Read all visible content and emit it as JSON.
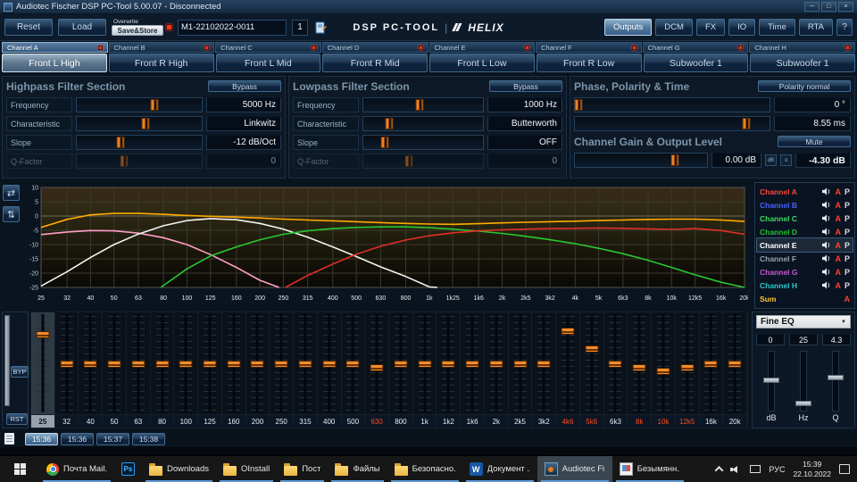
{
  "titlebar": {
    "title": "Audiotec Fischer DSP PC-Tool 5.00.07 - Disconnected"
  },
  "toolbar": {
    "reset": "Reset",
    "load": "Load",
    "overwrite_label": "Overwrite",
    "save_store": "Save&Store",
    "preset_name": "M1-22102022-0011",
    "preset_number": "1",
    "logo_left": "DSP PC-TOOL",
    "logo_sep": "|",
    "logo_brand": "HELIX",
    "right_buttons": [
      "Outputs",
      "DCM",
      "FX",
      "IO",
      "Time",
      "RTA"
    ],
    "help": "?"
  },
  "channel_tabs": [
    {
      "label": "Channel A",
      "active": true
    },
    {
      "label": "Channel B"
    },
    {
      "label": "Channel C"
    },
    {
      "label": "Channel D"
    },
    {
      "label": "Channel E"
    },
    {
      "label": "Channel F"
    },
    {
      "label": "Channel G"
    },
    {
      "label": "Channel H"
    }
  ],
  "channel_buttons": [
    {
      "label": "Front L High",
      "active": true
    },
    {
      "label": "Front R High"
    },
    {
      "label": "Front L Mid"
    },
    {
      "label": "Front R Mid"
    },
    {
      "label": "Front L Low"
    },
    {
      "label": "Front R Low"
    },
    {
      "label": "Subwoofer 1"
    },
    {
      "label": "Subwoofer 1"
    }
  ],
  "highpass": {
    "title": "Highpass Filter Section",
    "bypass": "Bypass",
    "rows": [
      {
        "label": "Frequency",
        "value": "5000 Hz",
        "pos": 62
      },
      {
        "label": "Characteristic",
        "value": "Linkwitz",
        "pos": 55
      },
      {
        "label": "Slope",
        "value": "-12 dB/Oct",
        "pos": 35
      },
      {
        "label": "Q-Factor",
        "value": "0",
        "pos": 38,
        "disabled": true
      }
    ]
  },
  "lowpass": {
    "title": "Lowpass Filter Section",
    "bypass": "Bypass",
    "rows": [
      {
        "label": "Frequency",
        "value": "1000 Hz",
        "pos": 47
      },
      {
        "label": "Characteristic",
        "value": "Butterworth",
        "pos": 22
      },
      {
        "label": "Slope",
        "value": "OFF",
        "pos": 18
      },
      {
        "label": "Q-Factor",
        "value": "0",
        "pos": 38,
        "disabled": true
      }
    ]
  },
  "phase": {
    "title": "Phase, Polarity & Time",
    "polarity_button": "Polarity normal",
    "deg_value": "0 °",
    "deg_pos": 2,
    "ms_value": "8.55 ms",
    "ms_pos": 88
  },
  "gain": {
    "title": "Channel Gain & Output Level",
    "mute_button": "Mute",
    "gain_value": "0.00 dB",
    "gain_pos": 76,
    "level_value": "-4.30 dB"
  },
  "chart_data": {
    "type": "line",
    "x_scale": "log",
    "xlim": [
      25,
      20000
    ],
    "ylim": [
      -25,
      10
    ],
    "ylabel": "dB",
    "xlabel": "Hz",
    "grid": true,
    "y_ticks": [
      10,
      5,
      0,
      -5,
      -10,
      -15,
      -20,
      -25
    ],
    "x_ticks": [
      25,
      32,
      40,
      50,
      63,
      80,
      100,
      125,
      160,
      200,
      250,
      315,
      400,
      500,
      630,
      800,
      1000,
      1250,
      1600,
      2000,
      2500,
      3150,
      4000,
      5000,
      6300,
      8000,
      10000,
      12500,
      16000,
      20000
    ],
    "x_tick_labels": [
      "25",
      "32",
      "40",
      "50",
      "63",
      "80",
      "100",
      "125",
      "160",
      "200",
      "250",
      "315",
      "400",
      "500",
      "630",
      "800",
      "1k",
      "1k25",
      "1k6",
      "2k",
      "2k5",
      "3k2",
      "4k",
      "5k",
      "6k3",
      "8k",
      "10k",
      "12k5",
      "16k",
      "20k"
    ],
    "series": [
      {
        "name": "orange",
        "color": "#ffaa00",
        "points": [
          [
            25,
            -4
          ],
          [
            32,
            -1.2
          ],
          [
            40,
            0.4
          ],
          [
            50,
            0.9
          ],
          [
            63,
            0.9
          ],
          [
            80,
            0.6
          ],
          [
            100,
            0.2
          ],
          [
            125,
            -0.1
          ],
          [
            160,
            -0.4
          ],
          [
            200,
            -0.7
          ],
          [
            250,
            -1.1
          ],
          [
            315,
            -1.4
          ],
          [
            400,
            -1.7
          ],
          [
            500,
            -2
          ],
          [
            630,
            -2.3
          ],
          [
            800,
            -2.6
          ],
          [
            1000,
            -2.8
          ],
          [
            1250,
            -2.9
          ],
          [
            1600,
            -2.7
          ],
          [
            2000,
            -2.4
          ],
          [
            2500,
            -2.2
          ],
          [
            3150,
            -2
          ],
          [
            4000,
            -1.8
          ],
          [
            5000,
            -1.6
          ],
          [
            6300,
            -1.4
          ],
          [
            8000,
            -1.2
          ],
          [
            10000,
            -1.1
          ],
          [
            12500,
            -1.1
          ],
          [
            16000,
            -1.4
          ],
          [
            20000,
            -1.9
          ]
        ]
      },
      {
        "name": "pink",
        "color": "#ff9fc8",
        "points": [
          [
            25,
            -6.5
          ],
          [
            32,
            -5.6
          ],
          [
            40,
            -5.1
          ],
          [
            50,
            -5.2
          ],
          [
            63,
            -6
          ],
          [
            80,
            -7.6
          ],
          [
            100,
            -10
          ],
          [
            125,
            -13.5
          ],
          [
            160,
            -18
          ],
          [
            200,
            -22.5
          ],
          [
            240,
            -25
          ]
        ]
      },
      {
        "name": "white",
        "color": "#f2f2f2",
        "points": [
          [
            25,
            -24.5
          ],
          [
            32,
            -19.5
          ],
          [
            40,
            -14.5
          ],
          [
            50,
            -10
          ],
          [
            63,
            -6.3
          ],
          [
            80,
            -3.4
          ],
          [
            100,
            -1.6
          ],
          [
            125,
            -0.9
          ],
          [
            160,
            -1.3
          ],
          [
            200,
            -2.6
          ],
          [
            250,
            -4.6
          ],
          [
            315,
            -7.4
          ],
          [
            400,
            -10.8
          ],
          [
            500,
            -14.2
          ],
          [
            630,
            -17.8
          ],
          [
            800,
            -21.2
          ],
          [
            1000,
            -24.8
          ],
          [
            1080,
            -25
          ]
        ]
      },
      {
        "name": "green",
        "color": "#28c832",
        "points": [
          [
            78,
            -25
          ],
          [
            100,
            -18.5
          ],
          [
            125,
            -14
          ],
          [
            160,
            -10.8
          ],
          [
            200,
            -8.3
          ],
          [
            250,
            -6.4
          ],
          [
            315,
            -5.2
          ],
          [
            400,
            -4.4
          ],
          [
            500,
            -4
          ],
          [
            630,
            -3.8
          ],
          [
            800,
            -3.8
          ],
          [
            1000,
            -4.1
          ],
          [
            1250,
            -4.6
          ],
          [
            1600,
            -5.3
          ],
          [
            2000,
            -6.1
          ],
          [
            2500,
            -7.1
          ],
          [
            3150,
            -8.3
          ],
          [
            4000,
            -9.7
          ],
          [
            5000,
            -11.3
          ],
          [
            6300,
            -13.2
          ],
          [
            8000,
            -15.5
          ],
          [
            10000,
            -18
          ],
          [
            12500,
            -20.6
          ],
          [
            16000,
            -23.2
          ],
          [
            20000,
            -25
          ]
        ]
      },
      {
        "name": "red",
        "color": "#e03028",
        "points": [
          [
            255,
            -25
          ],
          [
            315,
            -20.8
          ],
          [
            400,
            -16.8
          ],
          [
            500,
            -13.4
          ],
          [
            630,
            -10.6
          ],
          [
            800,
            -8.4
          ],
          [
            1000,
            -6.9
          ],
          [
            1250,
            -5.9
          ],
          [
            1600,
            -5.2
          ],
          [
            2000,
            -4.8
          ],
          [
            2500,
            -4.6
          ],
          [
            3150,
            -4.4
          ],
          [
            4000,
            -4.3
          ],
          [
            5000,
            -4.2
          ],
          [
            6300,
            -4.3
          ],
          [
            8000,
            -4.5
          ],
          [
            10000,
            -4.7
          ],
          [
            12500,
            -4.4
          ],
          [
            16000,
            -5.1
          ],
          [
            20000,
            -6.4
          ]
        ]
      }
    ]
  },
  "channels_panel": {
    "items": [
      {
        "label": "Channel A",
        "color": "#ff4438",
        "a": "A",
        "p": "P"
      },
      {
        "label": "Channel B",
        "color": "#4a62ff",
        "a": "A",
        "p": "P"
      },
      {
        "label": "Channel C",
        "color": "#3ddc64",
        "a": "A",
        "p": "P"
      },
      {
        "label": "Channel D",
        "color": "#1fc22e",
        "a": "A",
        "p": "P"
      },
      {
        "label": "Channel E",
        "color": "#ffffff",
        "a": "A",
        "p": "P",
        "selected": true
      },
      {
        "label": "Channel F",
        "color": "#98a2aa",
        "a": "A",
        "p": "P"
      },
      {
        "label": "Channel G",
        "color": "#c85ad2",
        "a": "A",
        "p": "P"
      },
      {
        "label": "Channel H",
        "color": "#2fc8c8",
        "a": "A",
        "p": "P"
      },
      {
        "label": "Sum",
        "color": "#ffc832",
        "a": "A",
        "sum": true
      }
    ]
  },
  "eq": {
    "byp": "BYP",
    "rst": "RST",
    "range_db": 12,
    "bands": [
      {
        "label": "25",
        "gain": 8,
        "selected": true
      },
      {
        "label": "32",
        "gain": 0
      },
      {
        "label": "40",
        "gain": 0
      },
      {
        "label": "50",
        "gain": 0
      },
      {
        "label": "63",
        "gain": 0
      },
      {
        "label": "80",
        "gain": 0
      },
      {
        "label": "100",
        "gain": 0
      },
      {
        "label": "125",
        "gain": 0
      },
      {
        "label": "160",
        "gain": 0
      },
      {
        "label": "200",
        "gain": 0
      },
      {
        "label": "250",
        "gain": 0
      },
      {
        "label": "315",
        "gain": 0
      },
      {
        "label": "400",
        "gain": 0
      },
      {
        "label": "500",
        "gain": 0
      },
      {
        "label": "630",
        "gain": -1,
        "red": true
      },
      {
        "label": "800",
        "gain": 0
      },
      {
        "label": "1k",
        "gain": 0
      },
      {
        "label": "1k2",
        "gain": 0
      },
      {
        "label": "1k6",
        "gain": 0
      },
      {
        "label": "2k",
        "gain": 0
      },
      {
        "label": "2k5",
        "gain": 0
      },
      {
        "label": "3k2",
        "gain": 0
      },
      {
        "label": "4k6",
        "gain": 9,
        "red": true
      },
      {
        "label": "5k6",
        "gain": 4,
        "red": true
      },
      {
        "label": "6k3",
        "gain": 0
      },
      {
        "label": "8k",
        "gain": -1,
        "red": true
      },
      {
        "label": "10k",
        "gain": -2,
        "red": true
      },
      {
        "label": "12k5",
        "gain": -1,
        "red": true
      },
      {
        "label": "16k",
        "gain": 0
      },
      {
        "label": "20k",
        "gain": 0
      }
    ]
  },
  "fine_eq": {
    "selector": "Fine EQ",
    "readouts": [
      "0",
      "25",
      "4.3"
    ],
    "sliders": [
      {
        "label": "dB",
        "pos": 45
      },
      {
        "label": "Hz",
        "pos": 80
      },
      {
        "label": "Q",
        "pos": 40
      }
    ]
  },
  "memory_tabs": [
    {
      "label": "15:36",
      "active": true
    },
    {
      "label": "15:36"
    },
    {
      "label": "15:37"
    },
    {
      "label": "15:38"
    }
  ],
  "taskbar": {
    "apps": [
      {
        "icon": "chrome",
        "label": "Почта Mail...",
        "open": true
      },
      {
        "icon": "photoshop",
        "label": "",
        "open": false
      },
      {
        "icon": "folder",
        "label": "Downloads",
        "open": true
      },
      {
        "icon": "folder",
        "label": "OInstall",
        "open": true
      },
      {
        "icon": "folder",
        "label": "Пост",
        "open": true
      },
      {
        "icon": "folder",
        "label": "Файлы",
        "open": true
      },
      {
        "icon": "folder",
        "label": "Безопасно...",
        "open": true
      },
      {
        "icon": "word",
        "label": "Документ ...",
        "open": true
      },
      {
        "icon": "audiotec",
        "label": "Audiotec Fi...",
        "open": true,
        "active": true
      },
      {
        "icon": "paint",
        "label": "Безымянн...",
        "open": true
      }
    ],
    "tray": {
      "lang": "РУС",
      "time": "15:39",
      "date": "22.10.2022"
    }
  }
}
